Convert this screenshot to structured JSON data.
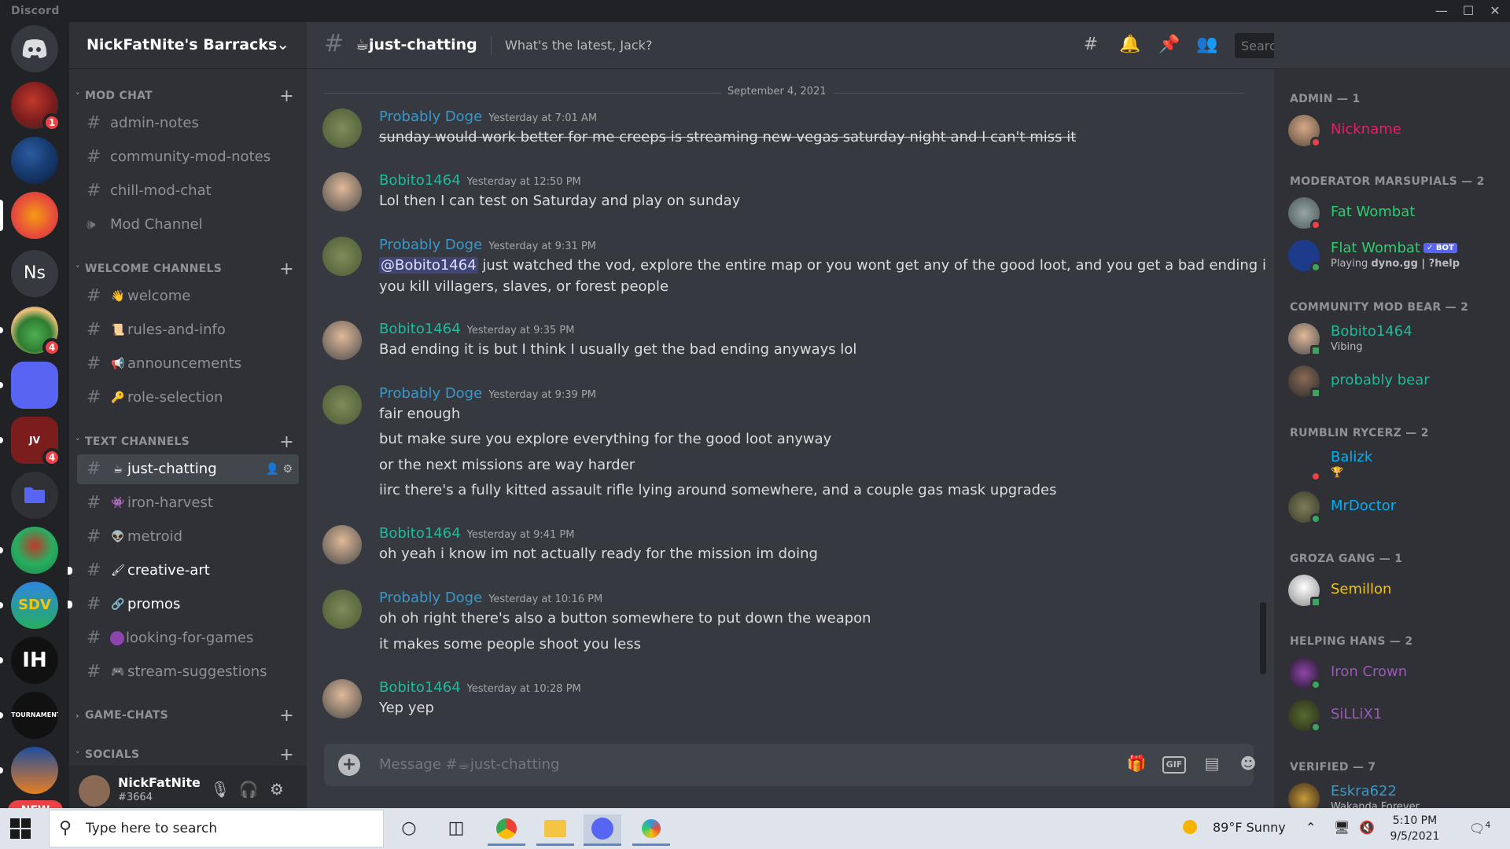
{
  "window": {
    "title": "Discord"
  },
  "server": {
    "name": "NickFatNite's Barracks"
  },
  "servers": [
    {
      "name": "Direct Messages"
    },
    {
      "name": "Red server",
      "badge": "1"
    },
    {
      "name": "Planet server"
    },
    {
      "name": "Active server"
    },
    {
      "name": "Ns",
      "initials": "Ns"
    },
    {
      "name": "Pepe server",
      "badge": "4"
    },
    {
      "name": "Purple server"
    },
    {
      "name": "JV server",
      "badge": "4",
      "initials": "JV"
    },
    {
      "name": "Folder"
    },
    {
      "name": "Mushroom server"
    },
    {
      "name": "SDV server",
      "initials": "SDV"
    },
    {
      "name": "IH server",
      "initials": "IH"
    },
    {
      "name": "Tournament server",
      "initials": "TOURNAMENT"
    },
    {
      "name": "Sunset server"
    }
  ],
  "new_label": "NEW",
  "categories": {
    "mod": "MOD CHAT",
    "welcome": "WELCOME CHANNELS",
    "text": "TEXT CHANNELS",
    "game": "GAME-CHATS",
    "socials": "SOCIALS"
  },
  "channels": {
    "mod": [
      "admin-notes",
      "community-mod-notes",
      "chill-mod-chat",
      "Mod Channel"
    ],
    "welcome": [
      "welcome",
      "rules-and-info",
      "announcements",
      "role-selection"
    ],
    "text": [
      "just-chatting",
      "iron-harvest",
      "metroid",
      "creative-art",
      "promos",
      "looking-for-games",
      "stream-suggestions"
    ]
  },
  "user": {
    "name": "NickFatNite",
    "tag": "#3664"
  },
  "channel": {
    "name": "just-chatting",
    "topic": "What's the latest, Jack?"
  },
  "search": {
    "placeholder": "Search"
  },
  "date_divider": "September 4, 2021",
  "messages": [
    {
      "author": "Probably Doge",
      "time": "Yesterday at 7:01 AM",
      "lines": [
        "sunday would work better for me creeps is streaming new vegas saturday night and I can't miss it"
      ]
    },
    {
      "author": "Bobito1464",
      "time": "Yesterday at 12:50 PM",
      "lines": [
        "Lol then I can test on Saturday and play on sunday"
      ]
    },
    {
      "author": "Probably Doge",
      "time": "Yesterday at 9:31 PM",
      "mention": "@Bobito1464",
      "lines": [
        " just watched the vod, explore the entire map or you wont get any of the good loot, and you get a bad ending if",
        "you kill villagers, slaves, or forest people"
      ]
    },
    {
      "author": "Bobito1464",
      "time": "Yesterday at 9:35 PM",
      "lines": [
        "Bad ending it is but I think I usually get the bad ending anyways lol"
      ]
    },
    {
      "author": "Probably Doge",
      "time": "Yesterday at 9:39 PM",
      "lines": [
        "fair enough",
        "but make sure you explore everything for the good loot anyway",
        "or the next missions are way harder",
        "iirc there's a fully kitted assault rifle lying around somewhere, and a couple gas mask upgrades"
      ]
    },
    {
      "author": "Bobito1464",
      "time": "Yesterday at 9:41 PM",
      "lines": [
        "oh yeah i know im not actually ready for the mission im doing"
      ]
    },
    {
      "author": "Probably Doge",
      "time": "Yesterday at 10:16 PM",
      "lines": [
        "oh oh right there's also a button somewhere to put down the weapon",
        "it makes some people shoot you less"
      ]
    },
    {
      "author": "Bobito1464",
      "time": "Yesterday at 10:28 PM",
      "lines": [
        "Yep yep"
      ]
    }
  ],
  "composer": {
    "placeholder": "Message #☕just-chatting",
    "gif": "GIF"
  },
  "members": {
    "groups": [
      {
        "title": "ADMIN — 1"
      },
      {
        "title": "MODERATOR MARSUPIALS — 2"
      },
      {
        "title": "COMMUNITY MOD BEAR — 2"
      },
      {
        "title": "RUMBLIN RYCERZ — 2"
      },
      {
        "title": "GROZA GANG — 1"
      },
      {
        "title": "HELPING HANS — 2"
      },
      {
        "title": "VERIFIED — 7"
      }
    ],
    "list": [
      {
        "name": "Nickname",
        "color": "#e91e63"
      },
      {
        "name": "Fat Wombat",
        "color": "#2ecc71"
      },
      {
        "name": "Flat Wombat",
        "color": "#2ecc71",
        "badge": "✓ BOT",
        "activity_prefix": "Playing ",
        "activity": "dyno.gg | ?help"
      },
      {
        "name": "Bobito1464",
        "color": "#1abc9c",
        "status_text": "Vibing"
      },
      {
        "name": "probably bear",
        "color": "#1abc9c"
      },
      {
        "name": "Balizk",
        "color": "#00b0f4"
      },
      {
        "name": "MrDoctor",
        "color": "#00b0f4"
      },
      {
        "name": "Semillon",
        "color": "#f1c40f"
      },
      {
        "name": "Iron Crown",
        "color": "#9b59b6"
      },
      {
        "name": "SiLLiX1",
        "color": "#9b59b6"
      },
      {
        "name": "Eskra622",
        "color": "#3a97c9",
        "status_text": "Wakanda Forever"
      }
    ]
  },
  "taskbar": {
    "search_placeholder": "Type here to search",
    "weather": "89°F  Sunny",
    "time": "5:10 PM",
    "date": "9/5/2021",
    "notif_count": "4"
  }
}
